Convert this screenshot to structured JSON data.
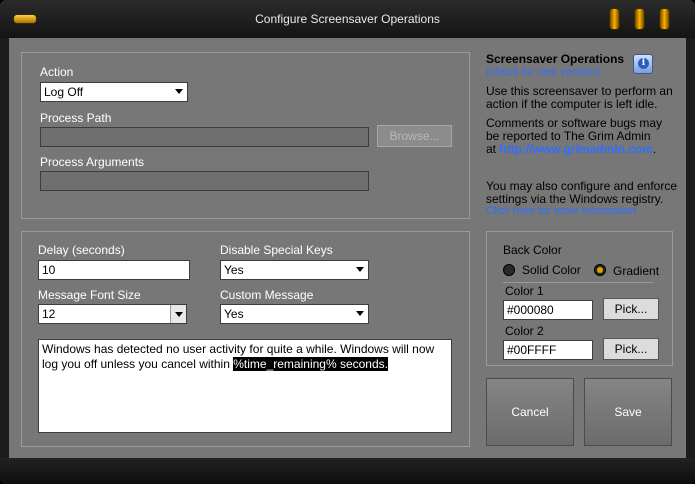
{
  "window": {
    "title": "Configure Screensaver Operations"
  },
  "action": {
    "label": "Action",
    "selected": "Log Off",
    "process_path_label": "Process Path",
    "process_path_value": "",
    "browse_label": "Browse...",
    "process_args_label": "Process Arguments",
    "process_args_value": ""
  },
  "options": {
    "delay_label": "Delay (seconds)",
    "delay_value": "10",
    "disable_keys_label": "Disable Special Keys",
    "disable_keys_value": "Yes",
    "font_size_label": "Message Font Size",
    "font_size_value": "12",
    "custom_message_label": "Custom Message",
    "custom_message_value": "Yes",
    "message_text": "Windows has detected no user activity for quite a while. Windows will now log you off unless you cancel within",
    "message_highlight": "%time_remaining% seconds."
  },
  "info": {
    "heading": "Screensaver Operations",
    "check_version": "(check for new version)",
    "p1_line1": "Use this screensaver to perform an",
    "p1_line2": "action if the computer is left idle.",
    "p2_line1": "Comments or software bugs may",
    "p2_line2": "be reported to The Grim Admin",
    "p2_at": "at",
    "p2_url": "http://www.grimadmin.com",
    "p2_dot": ".",
    "p3_line1": "You may also configure and enforce",
    "p3_line2": "settings via the Windows registry.",
    "p3_link": "Click here for more information"
  },
  "backcolor": {
    "label": "Back Color",
    "solid_label": "Solid Color",
    "gradient_label": "Gradient",
    "selected": "Gradient",
    "color1_label": "Color 1",
    "color1_value": "#000080",
    "color2_label": "Color 2",
    "color2_value": "#00FFFF",
    "pick_label": "Pick..."
  },
  "buttons": {
    "cancel": "Cancel",
    "save": "Save"
  },
  "colors": {
    "accent": "#ffb000",
    "link": "#2f6fff",
    "panel": "#777777"
  }
}
